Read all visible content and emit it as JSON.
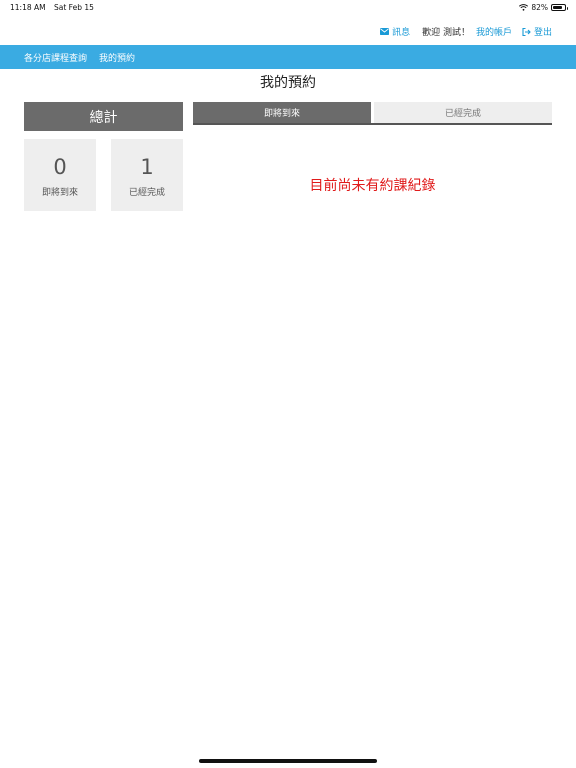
{
  "status_bar": {
    "time": "11:18 AM",
    "date": "Sat Feb 15",
    "battery_text": "82%",
    "battery_level": 0.82
  },
  "top_links": {
    "messages_label": "訊息",
    "welcome_text": "歡迎 測試！",
    "account_label": "我的帳戶",
    "logout_label": "登出"
  },
  "nav": {
    "items": [
      {
        "label": "各分店課程查詢"
      },
      {
        "label": "我的預約"
      }
    ]
  },
  "page": {
    "title": "我的預約"
  },
  "summary": {
    "header": "總計",
    "upcoming": {
      "value": "0",
      "label": "即將到來"
    },
    "completed": {
      "value": "1",
      "label": "已經完成"
    }
  },
  "tabs": {
    "upcoming": "即將到來",
    "completed": "已經完成"
  },
  "content": {
    "empty_message": "目前尚未有約課紀錄"
  },
  "colors": {
    "accent": "#3aabe2",
    "link": "#1a9ad6",
    "header_bg": "#6b6b6b",
    "box_bg": "#eeeeee",
    "empty_text": "#e01b1b"
  }
}
